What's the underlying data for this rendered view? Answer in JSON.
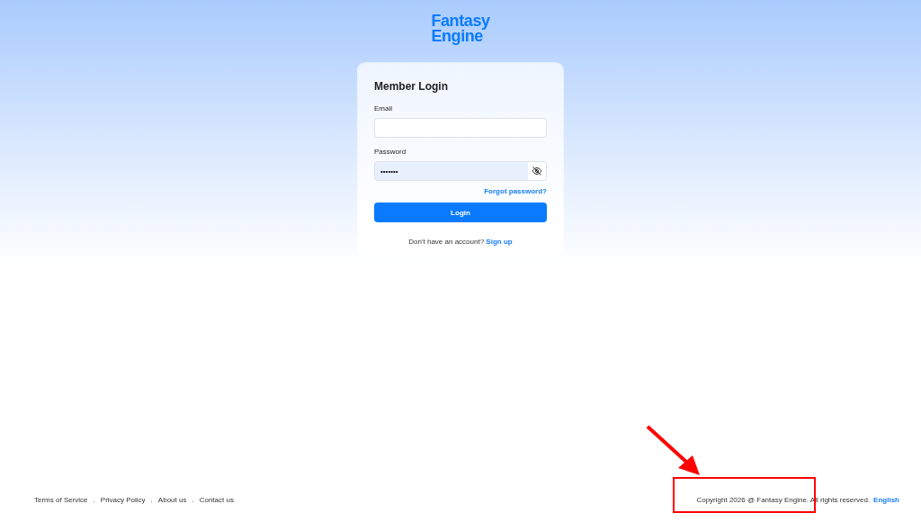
{
  "logo": {
    "lines": [
      "Fantasy",
      "Engine"
    ]
  },
  "login_card": {
    "title": "Member Login",
    "fields": [
      {
        "label": "Email",
        "kind": "text",
        "filled": false
      },
      {
        "label": "Password",
        "kind": "password",
        "value": "•••••••",
        "filled": true
      }
    ],
    "forgot_link": "Forgot password?",
    "submit": "Login",
    "signup_prompt": "Don't have an account?",
    "signup_link": "Sign up"
  },
  "footer": {
    "links": [
      {
        "label": "Terms of Service",
        "separator": "."
      },
      {
        "label": "Privacy Policy",
        "separator": "."
      },
      {
        "label": "About us",
        "separator": "."
      },
      {
        "label": "Contact us"
      }
    ],
    "copyright": "Copyright 2026 @ Fantasy Engine. All rights reserved.",
    "language": "English"
  },
  "annotation": {
    "color": "#ff0000"
  }
}
